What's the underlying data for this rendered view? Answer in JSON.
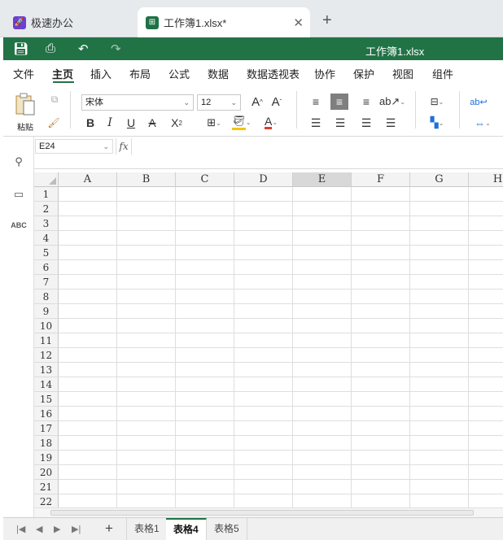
{
  "browser_tabs": [
    {
      "title": "极速办公",
      "icon": "rocket-icon"
    },
    {
      "title": "工作簿1.xlsx*",
      "icon": "spreadsheet-icon"
    }
  ],
  "title_bar": {
    "document_title": "工作簿1.xlsx",
    "color": "#217346"
  },
  "menu": {
    "items": [
      "文件",
      "主页",
      "插入",
      "布局",
      "公式",
      "数据",
      "数据透视表",
      "协作",
      "保护",
      "视图",
      "组件"
    ],
    "active": "主页"
  },
  "ribbon": {
    "paste_label": "粘贴",
    "font_name": "宋体",
    "font_size": "12",
    "grow_font": "A",
    "shrink_font": "A",
    "bold": "B",
    "italic": "I",
    "underline": "U",
    "strikethrough": "A",
    "subscript": "X",
    "font_color": "A"
  },
  "formula_bar": {
    "cell_reference": "E24",
    "fx_label": "fx",
    "formula": ""
  },
  "grid": {
    "columns": [
      "A",
      "B",
      "C",
      "D",
      "E",
      "F",
      "G",
      "H"
    ],
    "selected_column": "E",
    "rows": [
      "1",
      "2",
      "3",
      "4",
      "5",
      "6",
      "7",
      "8",
      "9",
      "10",
      "11",
      "12",
      "13",
      "14",
      "15",
      "16",
      "17",
      "18",
      "19",
      "20",
      "21",
      "22"
    ]
  },
  "sheet_tabs": {
    "tabs": [
      "表格1",
      "表格4",
      "表格5"
    ],
    "active": "表格4"
  }
}
